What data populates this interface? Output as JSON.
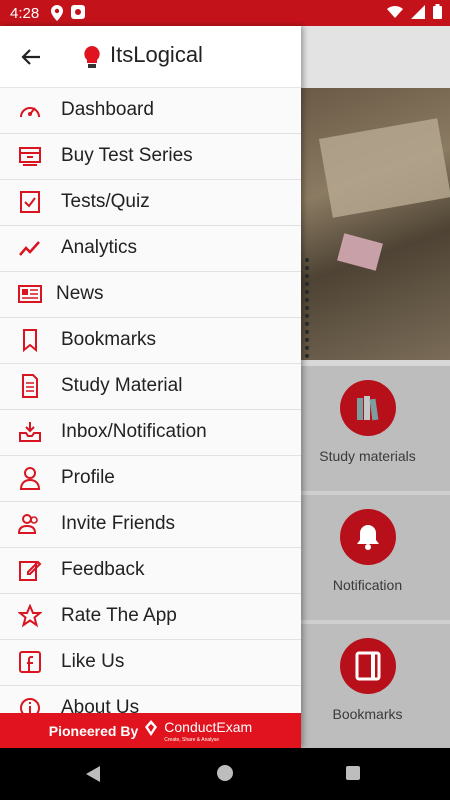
{
  "status_bar": {
    "time": "4:28"
  },
  "header": {
    "title": "ItsLogical"
  },
  "menu": [
    {
      "label": "Dashboard",
      "icon": "dashboard-icon"
    },
    {
      "label": "Buy Test Series",
      "icon": "cart-icon"
    },
    {
      "label": "Tests/Quiz",
      "icon": "quiz-icon"
    },
    {
      "label": "Analytics",
      "icon": "analytics-icon"
    },
    {
      "label": "News",
      "icon": "news-icon"
    },
    {
      "label": "Bookmarks",
      "icon": "bookmark-icon"
    },
    {
      "label": "Study Material",
      "icon": "document-icon"
    },
    {
      "label": "Inbox/Notification",
      "icon": "inbox-icon"
    },
    {
      "label": "Profile",
      "icon": "profile-icon"
    },
    {
      "label": "Invite Friends",
      "icon": "invite-icon"
    },
    {
      "label": "Feedback",
      "icon": "feedback-icon"
    },
    {
      "label": "Rate The App",
      "icon": "star-icon"
    },
    {
      "label": "Like Us",
      "icon": "facebook-icon"
    },
    {
      "label": "About Us",
      "icon": "info-icon"
    }
  ],
  "footer": {
    "text": "Pioneered By",
    "brand": "ConductExam",
    "tagline": "Create, Share & Analyse"
  },
  "background_tiles": [
    {
      "label": "Study materials",
      "icon": "books-icon"
    },
    {
      "label": "Notification",
      "icon": "bell-icon"
    },
    {
      "label": "Bookmarks",
      "icon": "notebook-icon"
    }
  ],
  "colors": {
    "accent": "#e0131f",
    "status_bar": "#c4121b"
  }
}
